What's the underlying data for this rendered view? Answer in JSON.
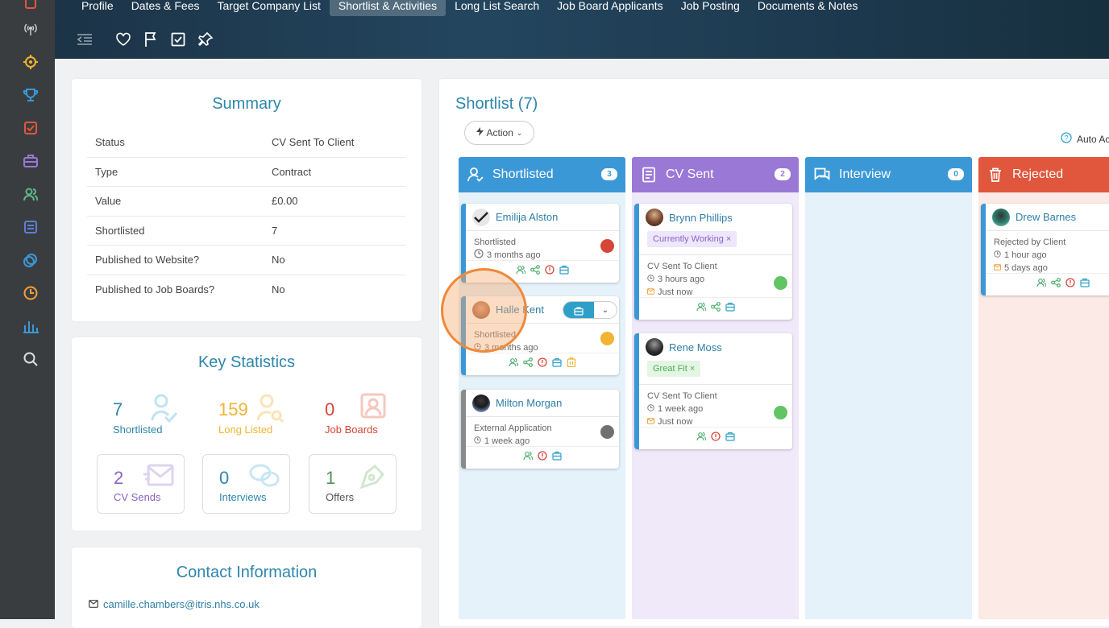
{
  "nav_tabs": [
    "Profile",
    "Dates & Fees",
    "Target Company List",
    "Shortlist & Activities",
    "Long List Search",
    "Job Board Applicants",
    "Job Posting",
    "Documents & Notes"
  ],
  "active_tab": "Shortlist & Activities",
  "rail_icons": [
    "antenna-icon",
    "target-icon",
    "trophy-icon",
    "checkbox-icon",
    "briefcase-icon",
    "people-icon",
    "document-icon",
    "money-icon",
    "clock-icon",
    "bar-chart-icon",
    "search-icon"
  ],
  "summary": {
    "title": "Summary",
    "rows": [
      {
        "k": "Status",
        "v": "CV Sent To Client"
      },
      {
        "k": "Type",
        "v": "Contract"
      },
      {
        "k": "Value",
        "v": "£0.00"
      },
      {
        "k": "Shortlisted",
        "v": "7"
      },
      {
        "k": "Published to Website?",
        "v": "No"
      },
      {
        "k": "Published to Job Boards?",
        "v": "No"
      }
    ]
  },
  "key_stats": {
    "title": "Key Statistics",
    "shortlisted": {
      "num": "7",
      "label": "Shortlisted",
      "color": "#2e86ab"
    },
    "long_listed": {
      "num": "159",
      "label": "Long Listed",
      "color": "#f0b432"
    },
    "job_boards": {
      "num": "0",
      "label": "Job Boards",
      "color": "#d64535"
    },
    "cv_sends": {
      "num": "2",
      "label": "CV Sends",
      "color": "#8a63c6"
    },
    "interviews": {
      "num": "0",
      "label": "Interviews",
      "color": "#2e86ab"
    },
    "offers": {
      "num": "1",
      "label": "Offers",
      "color": "#5a8f5a"
    }
  },
  "contact": {
    "title": "Contact Information",
    "email": "camille.chambers@itris.nhs.co.uk"
  },
  "shortlist": {
    "title": "Shortlist (7)",
    "action_label": "Action",
    "auto_label": "Auto Ac",
    "columns": [
      {
        "name": "Shortlisted",
        "count": "3",
        "color": "#3b98d6",
        "bg": "#e8f3fa"
      },
      {
        "name": "CV Sent",
        "count": "2",
        "color": "#9a78d6",
        "bg": "#f1ecfa"
      },
      {
        "name": "Interview",
        "count": "0",
        "color": "#3b98d6",
        "bg": "#e8f3fa"
      },
      {
        "name": "Rejected",
        "count": "",
        "color": "#e0573e",
        "bg": "#fbece7"
      }
    ],
    "cards": {
      "emilija": {
        "name": "Emilija Alston",
        "status": "Shortlisted",
        "time": "3 months ago",
        "dot": "#d64535"
      },
      "halle": {
        "name": "Halle Kent",
        "status": "Shortlisted",
        "time": "3 months ago",
        "dot": "#f0b432"
      },
      "milton": {
        "name": "Milton Morgan",
        "status": "External Application",
        "time": "1 week ago",
        "dot": "#707070"
      },
      "brynn": {
        "name": "Brynn Phillips",
        "tag": "Currently Working",
        "status": "CV Sent To Client",
        "time": "3 hours ago",
        "mail": "Just now",
        "dot": "#62c462"
      },
      "rene": {
        "name": "Rene Moss",
        "tag": "Great Fit",
        "status": "CV Sent To Client",
        "time": "1 week ago",
        "mail": "Just now",
        "dot": "#62c462"
      },
      "drew": {
        "name": "Drew Barnes",
        "status": "Rejected by Client",
        "time": "1 hour ago",
        "mail": "5 days ago"
      }
    },
    "tag_close": "×"
  }
}
